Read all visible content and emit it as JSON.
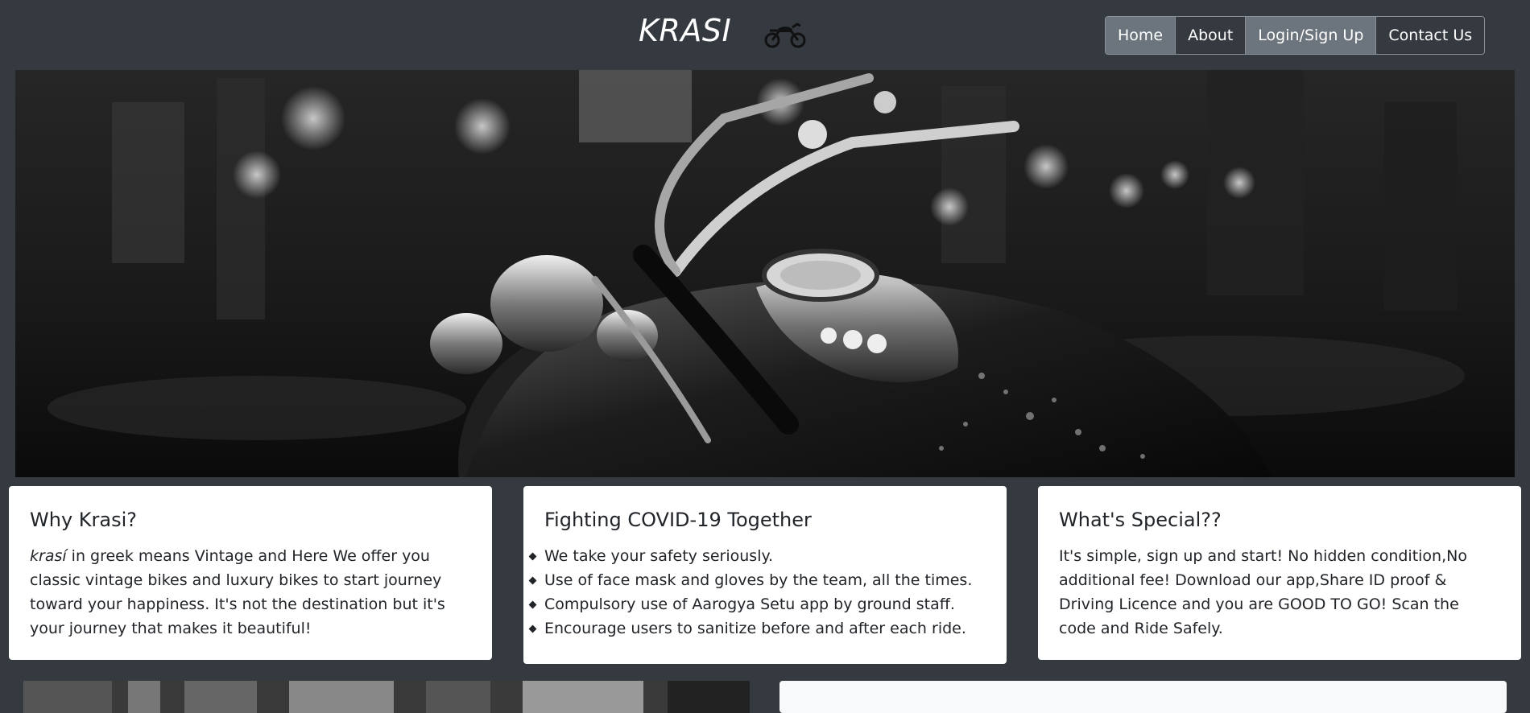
{
  "header": {
    "brand": "KRASI",
    "logo_icon": "motorcycle-icon"
  },
  "nav": {
    "items": [
      {
        "label": "Home"
      },
      {
        "label": "About"
      },
      {
        "label": "Login/Sign Up"
      },
      {
        "label": "Contact Us"
      }
    ]
  },
  "hero": {
    "image": "black-and-white motorcycle on wet street"
  },
  "cards": {
    "why": {
      "title": "Why Krasi?",
      "emphasis": "krasí",
      "body": " in greek means Vintage and Here We offer you classic vintage bikes and luxury bikes to start journey toward your happiness. It's not the destination but it's your journey that makes it beautiful!"
    },
    "covid": {
      "title": "Fighting COVID-19 Together",
      "items": [
        "We take your safety seriously.",
        "Use of face mask and gloves by the team, all the times.",
        "Compulsory use of Aarogya Setu app by ground staff.",
        "Encourage users to sanitize before and after each ride."
      ]
    },
    "special": {
      "title": "What's Special??",
      "body": "It's simple, sign up and start! No hidden condition,No additional fee! Download our app,Share ID proof & Driving Licence and you are GOOD TO GO! Scan the code and Ride Safely."
    }
  },
  "colors": {
    "background": "#343a40",
    "nav_filled": "#6c757d",
    "card_bg": "#ffffff",
    "text": "#212529"
  }
}
